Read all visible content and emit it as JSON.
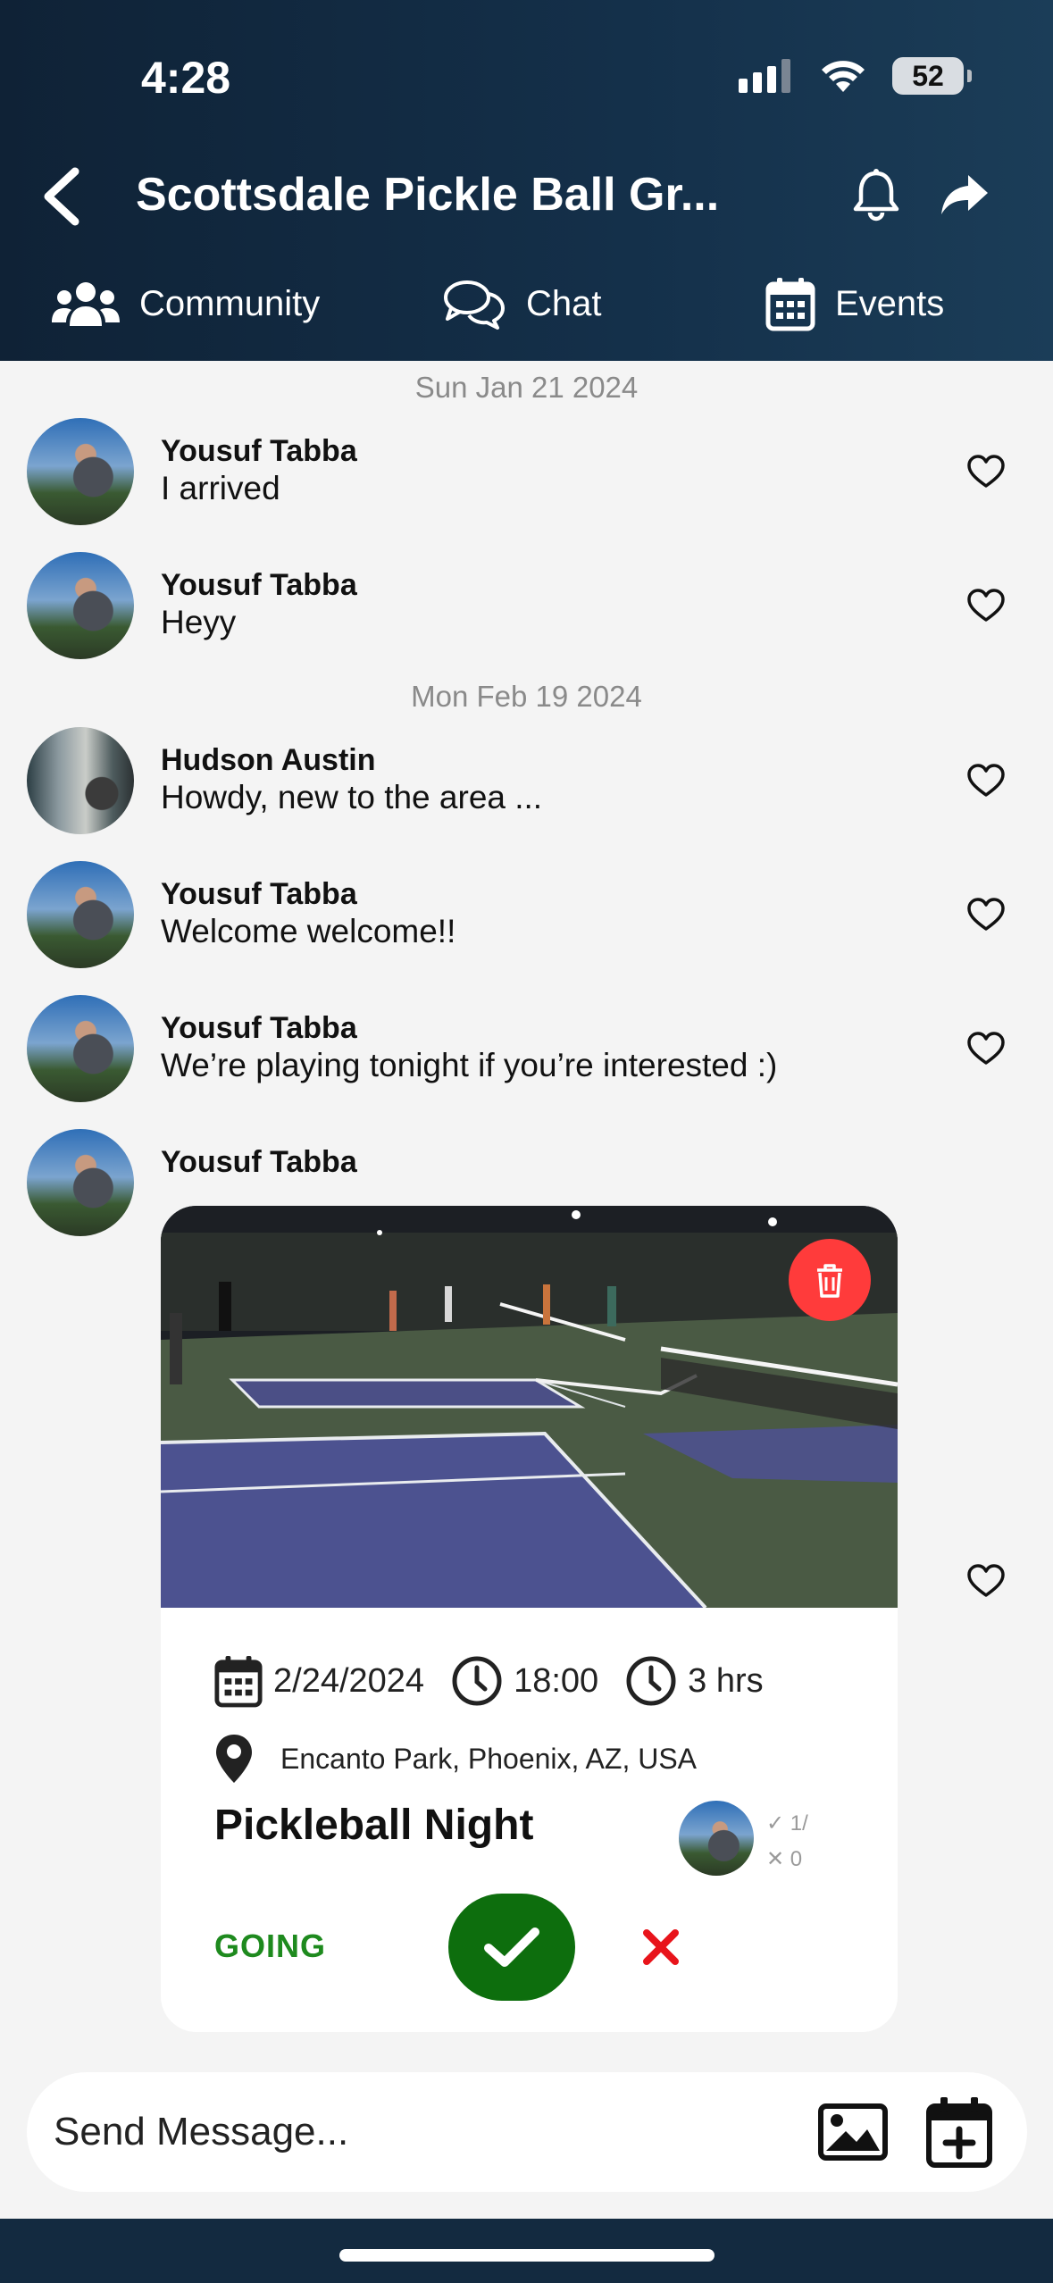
{
  "status": {
    "time": "4:28",
    "battery": "52"
  },
  "header": {
    "title": "Scottsdale Pickle Ball Gr..."
  },
  "tabs": [
    {
      "label": "Community",
      "icon": "users-icon"
    },
    {
      "label": "Chat",
      "icon": "chat-bubbles-icon"
    },
    {
      "label": "Events",
      "icon": "calendar-icon"
    }
  ],
  "dates": [
    "Sun Jan 21 2024",
    "Mon Feb 19 2024"
  ],
  "messages": [
    {
      "sender": "Yousuf Tabba",
      "text": "I arrived"
    },
    {
      "sender": "Yousuf Tabba",
      "text": "Heyy"
    },
    {
      "sender": "Hudson Austin",
      "text": "Howdy, new to the area ..."
    },
    {
      "sender": "Yousuf Tabba",
      "text": "Welcome welcome!!"
    },
    {
      "sender": "Yousuf Tabba",
      "text": "We’re playing tonight if you’re interested :)"
    },
    {
      "sender": "Yousuf Tabba"
    }
  ],
  "event": {
    "date": "2/24/2024",
    "time": "18:00",
    "duration": "3 hrs",
    "location": "Encanto Park, Phoenix, AZ, USA",
    "title": "Pickleball Night",
    "going_count": "✓ 1/",
    "not_going_count": "✕ 0",
    "status_label": "GOING"
  },
  "composer": {
    "placeholder": "Send Message..."
  },
  "colors": {
    "header_bg": "#14304a",
    "going_green": "#1e8a1e",
    "check_green": "#0d6e0d",
    "delete_red": "#ff3b3b",
    "decline_red": "#e8141b"
  }
}
